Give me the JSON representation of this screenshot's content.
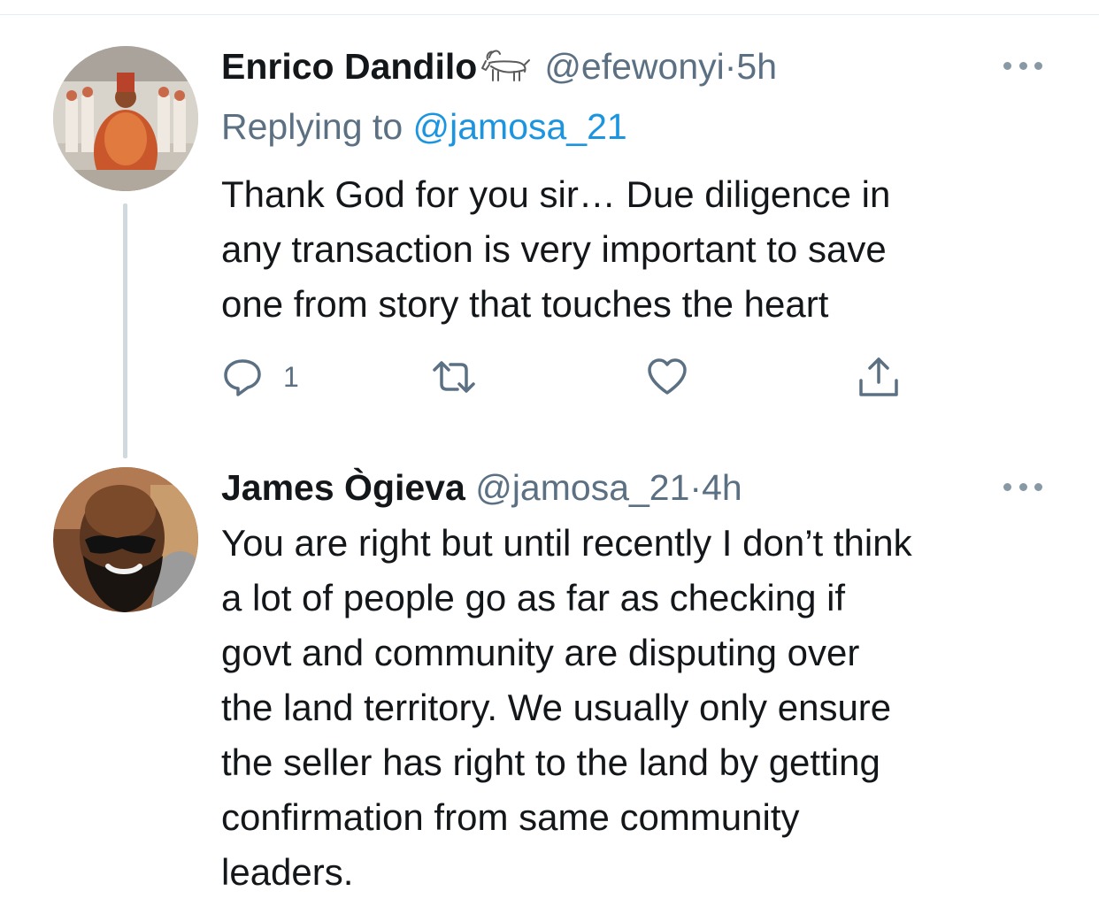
{
  "tweets": [
    {
      "author_name": "Enrico Dandilo",
      "badge_icon": "goat-emoji-icon",
      "handle": "@efewonyi",
      "separator": "·",
      "time": "5h",
      "replying_prefix": "Replying to ",
      "replying_mention": "@jamosa_21",
      "text_lines": [
        "Thank God for you sir… Due diligence in",
        "any transaction is very important to save",
        "one from story that touches the heart"
      ],
      "reply_count": "1",
      "icons": [
        "reply-icon",
        "retweet-icon",
        "like-icon",
        "share-icon",
        "more-icon"
      ]
    },
    {
      "author_name": "James Ògieva",
      "handle": "@jamosa_21",
      "separator": "·",
      "time": "4h",
      "text_lines": [
        "You are right but until recently I don’t think",
        "a lot of people go as far as checking if",
        "govt and community are disputing over",
        "the land territory. We usually only ensure",
        "the seller has right to the land by getting",
        "confirmation from same community",
        "leaders."
      ],
      "icons": [
        "more-icon"
      ]
    }
  ],
  "colors": {
    "text": "#14171a",
    "secondary": "#5b7083",
    "link": "#1b95e0",
    "thread_line": "#cfd9de"
  }
}
